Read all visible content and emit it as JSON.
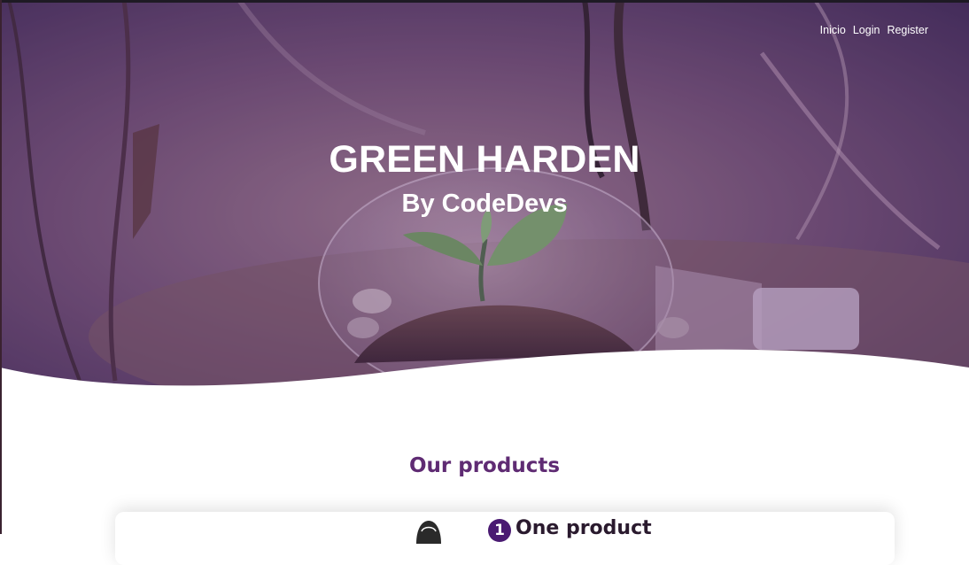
{
  "nav": {
    "items": [
      {
        "label": "Inicio"
      },
      {
        "label": "Login"
      },
      {
        "label": "Register"
      }
    ]
  },
  "hero": {
    "title": "GREEN HARDEN",
    "subtitle": "By CodeDevs",
    "image": "lightbulb-sprout-photo",
    "overlay_color": "#5a2f78"
  },
  "products": {
    "heading": "Our products",
    "items": [
      {
        "number": "1",
        "title": "One product",
        "icon": "avatar-icon"
      }
    ]
  },
  "colors": {
    "accent": "#5f2b73",
    "badge": "#4a1a72"
  }
}
